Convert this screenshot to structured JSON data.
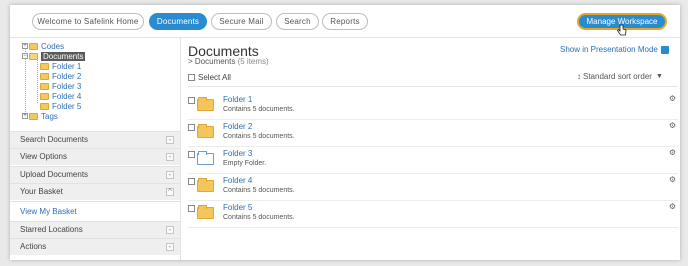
{
  "nav": {
    "tabs": [
      {
        "label": "Welcome to Safelink Home"
      },
      {
        "label": "Documents"
      },
      {
        "label": "Secure Mail"
      },
      {
        "label": "Search"
      },
      {
        "label": "Reports"
      }
    ],
    "manage_label": "Manage Workspace"
  },
  "tree": {
    "codes": "Codes",
    "documents": "Documents",
    "folders": [
      "Folder 1",
      "Folder 2",
      "Folder 3",
      "Folder 4",
      "Folder 5"
    ],
    "tags": "Tags"
  },
  "sidebar": {
    "sections": [
      {
        "label": "Search Documents",
        "toggle": "-"
      },
      {
        "label": "View Options",
        "toggle": "-"
      },
      {
        "label": "Upload Documents",
        "toggle": "-"
      },
      {
        "label": "Your Basket",
        "toggle": "^"
      },
      {
        "label": "View My Basket",
        "toggle": ""
      },
      {
        "label": "Starred Locations",
        "toggle": "-"
      },
      {
        "label": "Actions",
        "toggle": "-"
      }
    ]
  },
  "main": {
    "title": "Documents",
    "crumb_prefix": "> Documents",
    "crumb_count": "(5 items)",
    "presentation": "Show in Presentation Mode",
    "select_all": "Select All",
    "sort": "Standard sort order",
    "items": [
      {
        "name": "Folder 1",
        "desc": "Contains 5 documents."
      },
      {
        "name": "Folder 2",
        "desc": "Contains 5 documents."
      },
      {
        "name": "Folder 3",
        "desc": "Empty Folder."
      },
      {
        "name": "Folder 4",
        "desc": "Contains 5 documents."
      },
      {
        "name": "Folder 5",
        "desc": "Contains 5 documents."
      }
    ]
  },
  "colors": {
    "accent": "#2a8cd0",
    "highlight": "#e2a72a",
    "link": "#2a6fb8",
    "folder": "#f6c55a"
  }
}
